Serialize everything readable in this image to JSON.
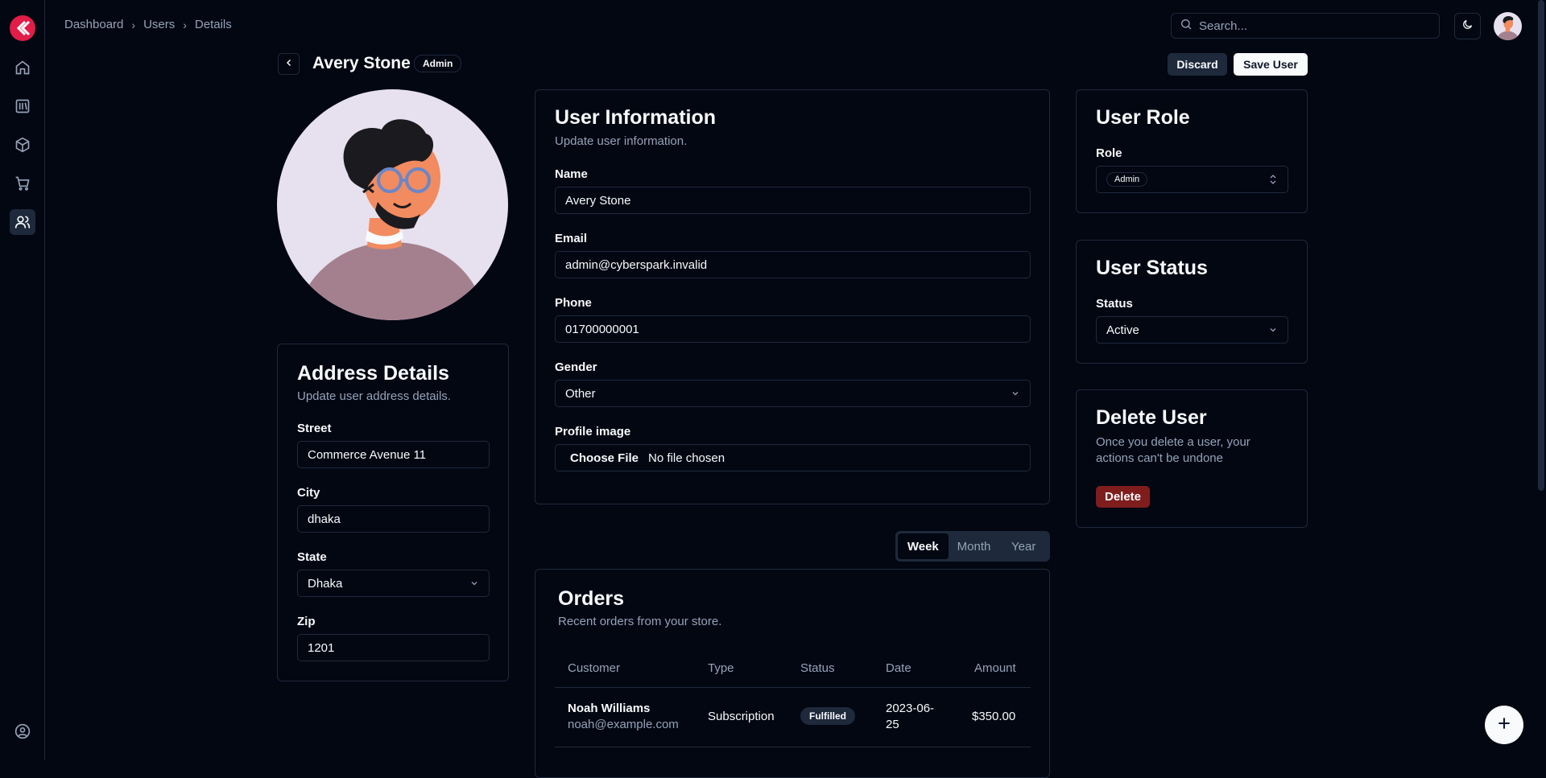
{
  "breadcrumb": [
    "Dashboard",
    "Users",
    "Details"
  ],
  "search": {
    "placeholder": "Search..."
  },
  "header": {
    "name": "Avery Stone",
    "role_badge": "Admin",
    "discard": "Discard",
    "save": "Save User"
  },
  "user_info": {
    "title": "User Information",
    "description": "Update user information.",
    "name_label": "Name",
    "name_value": "Avery Stone",
    "email_label": "Email",
    "email_value": "admin@cyberspark.invalid",
    "phone_label": "Phone",
    "phone_value": "01700000001",
    "gender_label": "Gender",
    "gender_value": "Other",
    "image_label": "Profile image",
    "file_button": "Choose File",
    "file_status": "No file chosen"
  },
  "address": {
    "title": "Address Details",
    "description": "Update user address details.",
    "street_label": "Street",
    "street_value": "Commerce Avenue 11",
    "city_label": "City",
    "city_value": "dhaka",
    "state_label": "State",
    "state_value": "Dhaka",
    "zip_label": "Zip",
    "zip_value": "1201"
  },
  "role": {
    "title": "User Role",
    "label": "Role",
    "value": "Admin"
  },
  "status": {
    "title": "User Status",
    "label": "Status",
    "value": "Active"
  },
  "delete": {
    "title": "Delete User",
    "description_line1": "Once you delete a user, your",
    "description_line2": "actions can't be undone",
    "button": "Delete"
  },
  "period_tabs": [
    "Week",
    "Month",
    "Year"
  ],
  "orders": {
    "title": "Orders",
    "description": "Recent orders from your store.",
    "columns": [
      "Customer",
      "Type",
      "Status",
      "Date",
      "Amount"
    ],
    "rows": [
      {
        "customer": "Noah Williams",
        "email": "noah@example.com",
        "type": "Subscription",
        "status": "Fulfilled",
        "date_line1": "2023-06-",
        "date_line2": "25",
        "amount": "$350.00"
      }
    ]
  },
  "colors": {
    "background": "#030712",
    "border": "#1e293b",
    "accent_logo": "#e11d48",
    "danger": "#7f1d1d"
  },
  "icons": [
    "logo-icon",
    "home-icon",
    "library-icon",
    "package-icon",
    "cart-icon",
    "users-icon",
    "account-icon",
    "search-icon",
    "moon-icon",
    "chevron-left-icon",
    "chevron-down-icon",
    "chevrons-updown-icon",
    "plus-icon"
  ]
}
